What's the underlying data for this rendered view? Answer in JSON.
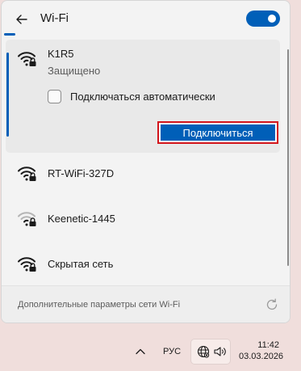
{
  "header": {
    "title": "Wi-Fi",
    "back_icon": "arrow-left-icon",
    "wifi_enabled": true,
    "accent": "#005fb8"
  },
  "networks": [
    {
      "name": "K1R5",
      "status": "Защищено",
      "secured": true,
      "expanded": true,
      "auto_connect_label": "Подключаться автоматически",
      "auto_connect_checked": false,
      "connect_label": "Подключиться",
      "icon": "wifi-lock-icon"
    },
    {
      "name": "RT-WiFi-327D",
      "secured": true,
      "icon": "wifi-lock-icon"
    },
    {
      "name": "Keenetic-1445",
      "secured": true,
      "icon": "wifi-lock-icon"
    },
    {
      "name": "Скрытая сеть",
      "secured": true,
      "icon": "wifi-lock-icon"
    }
  ],
  "footer": {
    "link": "Дополнительные параметры сети Wi-Fi",
    "refresh_icon": "refresh-icon"
  },
  "taskbar": {
    "chevron_icon": "chevron-up-icon",
    "language": "РУС",
    "network_icon": "globe-icon",
    "volume_icon": "speaker-icon",
    "time": "11:42",
    "date": "03.03.2026"
  },
  "colors": {
    "highlight_border": "#d4161c",
    "taskbar_bg": "#f0dedc"
  }
}
